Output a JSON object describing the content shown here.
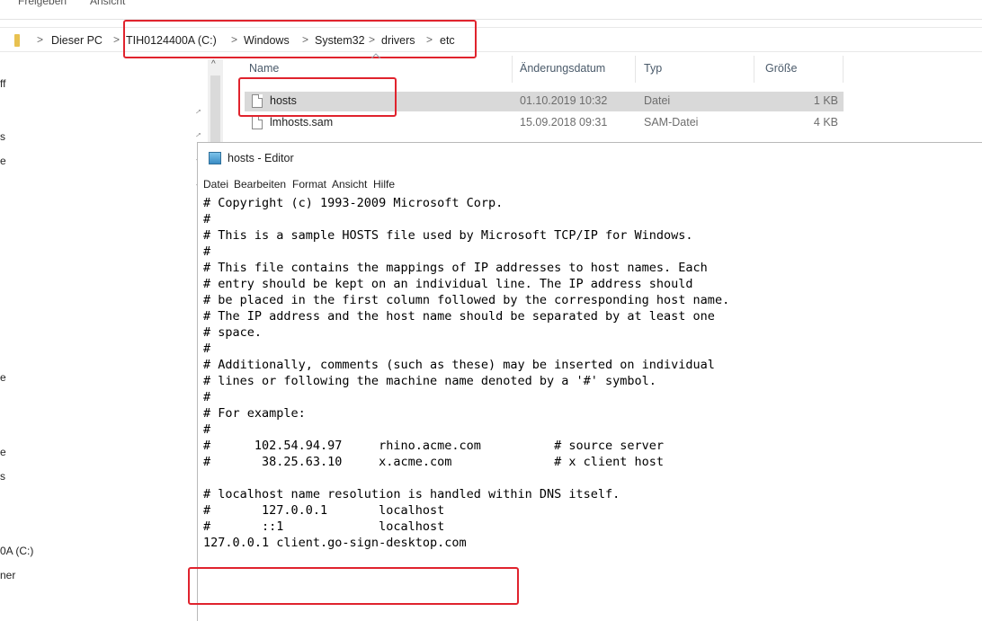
{
  "ribbon": {
    "tabs": [
      "Freigeben",
      "Ansicht"
    ]
  },
  "addressbar": {
    "separator": ">",
    "crumbs": [
      "Dieser PC",
      "TIH0124400A (C:)",
      "Windows",
      "System32",
      "drivers",
      "etc"
    ]
  },
  "nav_pane": {
    "fragments": [
      "ff",
      "s",
      "e",
      "e",
      "e",
      "s",
      "0A (C:)",
      "ner"
    ],
    "pin_glyph": "📌",
    "scroll_up": "^"
  },
  "file_list": {
    "columns": [
      "Name",
      "Änderungsdatum",
      "Typ",
      "Größe"
    ],
    "rows": [
      {
        "name": "hosts",
        "date": "01.10.2019 10:32",
        "type": "Datei",
        "size": "1 KB",
        "selected": true
      },
      {
        "name": "lmhosts.sam",
        "date": "15.09.2018 09:31",
        "type": "SAM-Datei",
        "size": "4 KB",
        "selected": false
      }
    ]
  },
  "notepad": {
    "title": "hosts - Editor",
    "menu": [
      "Datei",
      "Bearbeiten",
      "Format",
      "Ansicht",
      "Hilfe"
    ],
    "lines": [
      "# Copyright (c) 1993-2009 Microsoft Corp.",
      "#",
      "# This is a sample HOSTS file used by Microsoft TCP/IP for Windows.",
      "#",
      "# This file contains the mappings of IP addresses to host names. Each",
      "# entry should be kept on an individual line. The IP address should",
      "# be placed in the first column followed by the corresponding host name.",
      "# The IP address and the host name should be separated by at least one",
      "# space.",
      "#",
      "# Additionally, comments (such as these) may be inserted on individual",
      "# lines or following the machine name denoted by a '#' symbol.",
      "#",
      "# For example:",
      "#",
      "#      102.54.94.97     rhino.acme.com          # source server",
      "#       38.25.63.10     x.acme.com              # x client host",
      "",
      "# localhost name resolution is handled within DNS itself.",
      "#\t127.0.0.1       localhost",
      "#\t::1             localhost",
      "127.0.0.1 client.go-sign-desktop.com"
    ]
  },
  "colors": {
    "highlight_red": "#e0232d",
    "selected_row": "#d9d9d9"
  }
}
